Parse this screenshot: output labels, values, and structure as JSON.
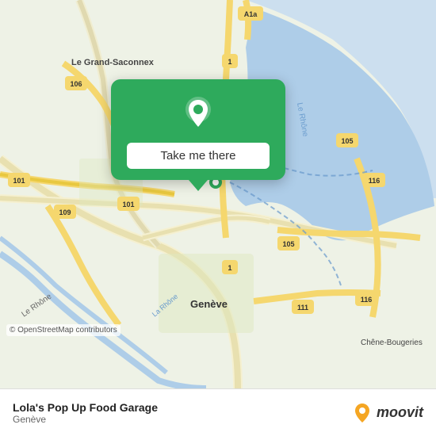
{
  "map": {
    "background_color": "#e8f0d8",
    "attribution": "© OpenStreetMap contributors"
  },
  "popup": {
    "button_label": "Take me there",
    "background_color": "#2eaa5c"
  },
  "footer": {
    "title": "Lola's Pop Up Food Garage",
    "subtitle": "Genève",
    "moovit_label": "moovit"
  }
}
